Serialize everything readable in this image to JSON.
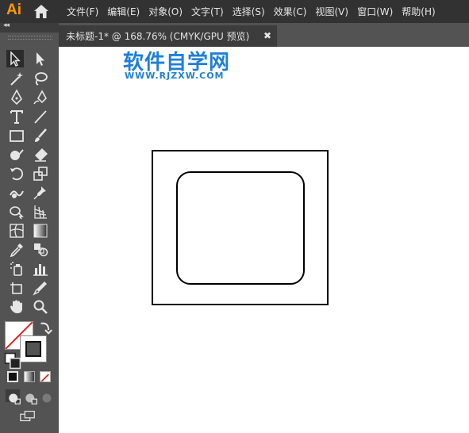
{
  "app": {
    "logo": "Ai",
    "watermark": {
      "title": "软件自学网",
      "url": "WWW.RJZXW.COM"
    }
  },
  "menu": [
    "文件(F)",
    "编辑(E)",
    "对象(O)",
    "文字(T)",
    "选择(S)",
    "效果(C)",
    "视图(V)",
    "窗口(W)",
    "帮助(H)"
  ],
  "document_tab": {
    "title": "未标题-1* @ 168.76% (CMYK/GPU 预览)",
    "close": "✖"
  },
  "toolbar": {
    "collapse": "◂◂",
    "tools": [
      "selection-tool",
      "direct-selection-tool",
      "magic-wand-tool",
      "lasso-tool",
      "pen-tool",
      "curvature-tool",
      "type-tool",
      "line-segment-tool",
      "rectangle-tool",
      "paintbrush-tool",
      "shaper-tool",
      "eraser-tool",
      "rotate-tool",
      "scale-tool",
      "warp-tool",
      "puppet-warp-tool",
      "shape-builder-tool",
      "perspective-grid-tool",
      "mesh-tool",
      "gradient-tool",
      "eyedropper-tool",
      "blend-tool",
      "symbol-sprayer-tool",
      "column-graph-tool",
      "artboard-tool",
      "slice-tool",
      "hand-tool",
      "zoom-tool"
    ]
  },
  "colors": {
    "menubar_bg": "#323232",
    "toolbar_bg": "#535353",
    "tab_bg": "#3c3c3c",
    "accent_logo": "#ff9a00",
    "watermark": "#1e7fd8"
  }
}
